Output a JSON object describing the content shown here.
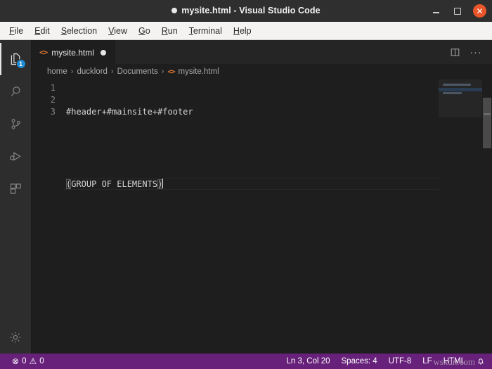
{
  "window": {
    "title": "mysite.html - Visual Studio Code",
    "dirty_indicator": "●",
    "controls": {
      "minimize": "minimize-icon",
      "maximize": "maximize-icon",
      "close": "✕"
    },
    "accent_close": "#e9562a"
  },
  "menubar": {
    "items": [
      {
        "mnemonic": "F",
        "rest": "ile"
      },
      {
        "mnemonic": "E",
        "rest": "dit"
      },
      {
        "mnemonic": "S",
        "rest": "election"
      },
      {
        "mnemonic": "V",
        "rest": "iew"
      },
      {
        "mnemonic": "G",
        "rest": "o"
      },
      {
        "mnemonic": "R",
        "rest": "un"
      },
      {
        "mnemonic": "T",
        "rest": "erminal"
      },
      {
        "mnemonic": "H",
        "rest": "elp"
      }
    ]
  },
  "activitybar": {
    "items": [
      {
        "name": "explorer",
        "icon": "files-icon",
        "badge": "1",
        "active": true
      },
      {
        "name": "search",
        "icon": "search-icon",
        "badge": "",
        "active": false
      },
      {
        "name": "source-control",
        "icon": "source-control-icon",
        "badge": "",
        "active": false
      },
      {
        "name": "run-and-debug",
        "icon": "run-debug-icon",
        "badge": "",
        "active": false
      },
      {
        "name": "extensions",
        "icon": "extensions-icon",
        "badge": "",
        "active": false
      }
    ],
    "manage": {
      "name": "manage-settings",
      "icon": "gear-icon"
    }
  },
  "tabs": {
    "open": [
      {
        "icon": "html-icon",
        "icon_glyph": "<>",
        "label": "mysite.html",
        "dirty": true,
        "active": true
      }
    ],
    "actions": {
      "split_editor": "split-editor-icon",
      "more_actions": "···"
    }
  },
  "breadcrumb": {
    "separator": "›",
    "items": [
      "home",
      "ducklord",
      "Documents"
    ],
    "file_icon_glyph": "<>",
    "file": "mysite.html"
  },
  "editor": {
    "line_numbers": [
      "1",
      "2",
      "3"
    ],
    "lines": [
      {
        "n": "1",
        "text": "#header+#mainsite+#footer",
        "current": false
      },
      {
        "n": "2",
        "text": "",
        "current": false
      },
      {
        "n": "3",
        "open_bracket": "(",
        "text": "GROUP OF ELEMENTS",
        "close_bracket": ")",
        "current": true
      }
    ]
  },
  "statusbar": {
    "errors_glyph": "⊗",
    "errors_count": "0",
    "warnings_glyph": "⚠",
    "warnings_count": "0",
    "cursor_position": "Ln 3, Col 20",
    "indentation": "Spaces: 4",
    "encoding": "UTF-8",
    "eol": "LF",
    "language": "HTML",
    "notifications_glyph": "🔔",
    "background": "#68217a"
  },
  "watermark": {
    "text": "wsxdn.com"
  }
}
